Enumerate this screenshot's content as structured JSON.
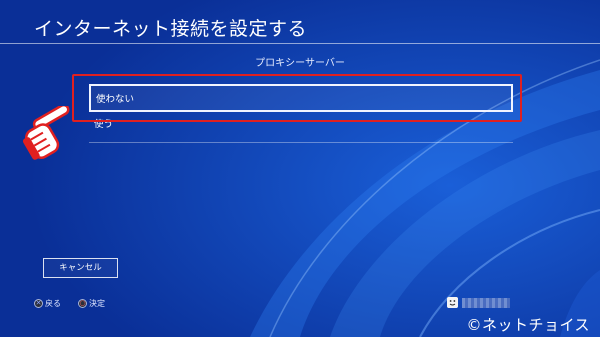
{
  "screen": {
    "title": "インターネット接続を設定する"
  },
  "proxy": {
    "section_label": "プロキシーサーバー",
    "options": [
      {
        "label": "使わない",
        "selected": true
      },
      {
        "label": "使う",
        "selected": false
      }
    ]
  },
  "buttons": {
    "cancel": "キャンセル"
  },
  "footer": {
    "back_label": "戻る",
    "confirm_label": "決定"
  },
  "watermark": "©ネットチョイス",
  "colors": {
    "background": "#0b3aa8",
    "highlight": "#e02020",
    "hand": "#e02020"
  },
  "icons": {
    "back": "cross-button-icon",
    "confirm": "circle-button-icon",
    "user": "user-face-icon",
    "pointer": "pointing-hand-icon"
  }
}
